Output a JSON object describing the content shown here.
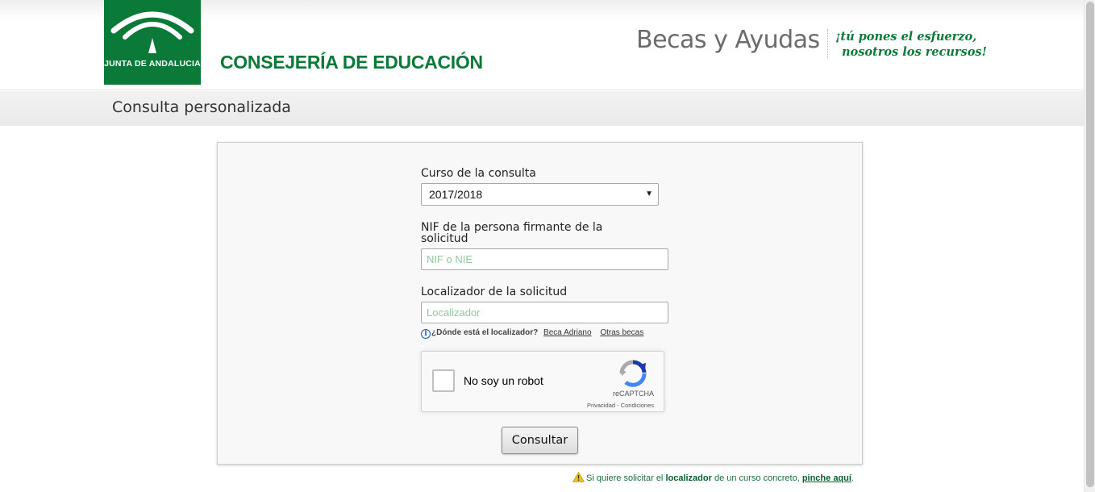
{
  "header": {
    "logo_text": "JUNTA DE ANDALUCIA",
    "department": "CONSEJERÍA DE EDUCACIÓN",
    "program": "Becas y Ayudas",
    "tagline_line1": "¡tú pones el esfuerzo,",
    "tagline_line2": "nosotros los recursos!"
  },
  "page": {
    "title": "Consulta personalizada"
  },
  "form": {
    "course_label": "Curso de la consulta",
    "course_value": "2017/2018",
    "nif_label": "NIF de la persona firmante de la solicitud",
    "nif_placeholder": "NIF o NIE",
    "locator_label": "Localizador de la solicitud",
    "locator_placeholder": "Localizador",
    "help_question": "¿Dónde está el localizador?",
    "help_link_1": "Beca Adriano",
    "help_link_2": "Otras becas",
    "submit_label": "Consultar"
  },
  "recaptcha": {
    "label": "No soy un robot",
    "brand": "reCAPTCHA",
    "privacy": "Privacidad",
    "separator": " - ",
    "terms": "Condiciones"
  },
  "footnote": {
    "prefix": "Si quiere solicitar el ",
    "bold": "localizador",
    "middle": " de un curso concreto, ",
    "link": "pinche aquí",
    "suffix": "."
  },
  "colors": {
    "brand_green": "#0b7a39",
    "placeholder_green": "#8fc99a",
    "warning_yellow": "#f2c11b"
  }
}
